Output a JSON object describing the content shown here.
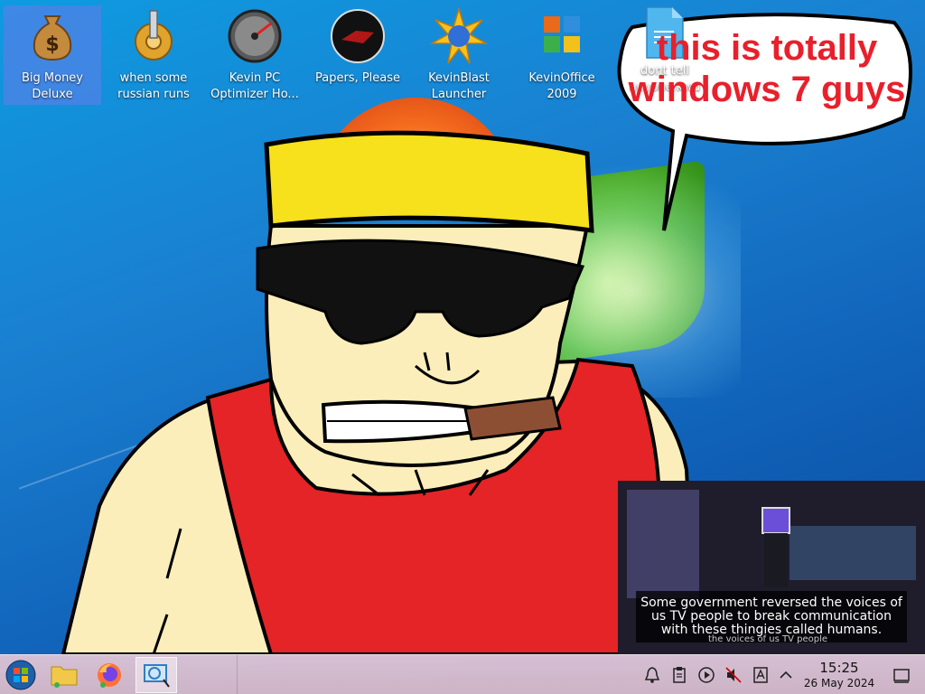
{
  "desktop": {
    "icons": [
      {
        "label": "Big Money Deluxe",
        "icon": "money-bag-icon"
      },
      {
        "label": "when some russian runs a...",
        "icon": "gear-icon"
      },
      {
        "label": "Kevin PC Optimizer Ho...",
        "icon": "speedometer-icon"
      },
      {
        "label": "Papers, Please",
        "icon": "seal-icon"
      },
      {
        "label": "KevinBlast Launcher",
        "icon": "burst-icon"
      },
      {
        "label": "KevinOffice 2009",
        "icon": "office-icon"
      }
    ],
    "file": {
      "label": "dont tell anyone.kwd",
      "icon": "document-icon"
    }
  },
  "bubble": {
    "text": "this is totally windows 7 guys"
  },
  "video": {
    "subtitle": "Some government reversed the voices of us TV people to break communication with these thingies called humans.",
    "subtitle_under": "the voices of us TV people"
  },
  "taskbar": {
    "start_icon": "start-orb-icon",
    "apps": [
      "file-manager-icon",
      "firefox-icon",
      "screenshot-tool-icon"
    ],
    "tray": [
      "notifications-icon",
      "clipboard-icon",
      "media-play-icon",
      "volume-muted-icon",
      "input-method-icon",
      "tray-expand-icon"
    ],
    "clock": {
      "time": "15:25",
      "date": "26 May 2024"
    },
    "show_desktop_icon": "show-desktop-icon"
  }
}
